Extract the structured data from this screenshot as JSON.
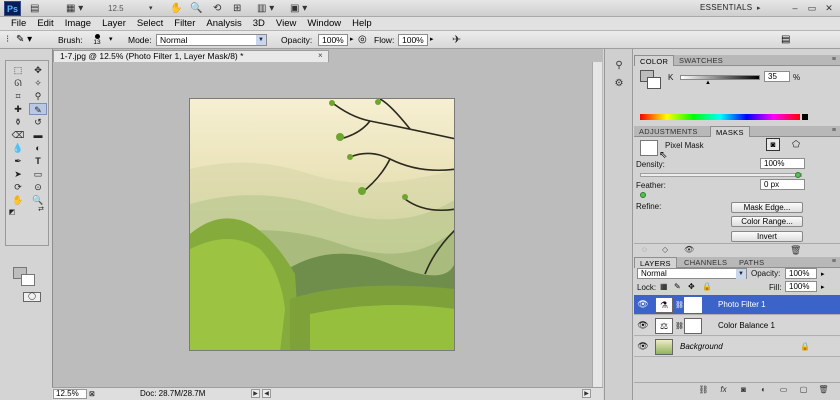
{
  "appbar": {
    "logo": "Ps",
    "zoom": "12.5",
    "workspace": "ESSENTIALS",
    "icons": [
      "document-icon",
      "hand-icon",
      "zoom-icon",
      "rotate-icon",
      "arrange-icon",
      "screen-mode-icon"
    ],
    "window_buttons": [
      "minimize-icon",
      "restore-icon",
      "close-icon"
    ]
  },
  "menu": [
    "File",
    "Edit",
    "Image",
    "Layer",
    "Select",
    "Filter",
    "Analysis",
    "3D",
    "View",
    "Window",
    "Help"
  ],
  "options": {
    "brush_label": "Brush:",
    "brush_size": "13",
    "mode_label": "Mode:",
    "mode_value": "Normal",
    "opacity_label": "Opacity:",
    "opacity_value": "100%",
    "flow_label": "Flow:",
    "flow_value": "100%"
  },
  "document": {
    "tab_title": "1-7.jpg @ 12.5% (Photo Filter 1, Layer Mask/8) *",
    "close": "×",
    "status_zoom": "12.5%",
    "doc_size": "Doc: 28.7M/28.7M"
  },
  "color_panel": {
    "tabs": [
      "COLOR",
      "SWATCHES"
    ],
    "channel_label": "K",
    "channel_value": "35",
    "unit": "%",
    "fg_color": "#bcbcbc"
  },
  "masks_panel": {
    "tabs": [
      "ADJUSTMENTS",
      "MASKS"
    ],
    "mask_type": "Pixel Mask",
    "density_label": "Density:",
    "density_value": "100%",
    "density_level": 1.0,
    "feather_label": "Feather:",
    "feather_value": "0 px",
    "feather_level": 0.0,
    "refine_label": "Refine:",
    "buttons": [
      "Mask Edge...",
      "Color Range...",
      "Invert"
    ]
  },
  "layers_panel": {
    "tabs": [
      "LAYERS",
      "CHANNELS",
      "PATHS"
    ],
    "blend_mode": "Normal",
    "opacity_label": "Opacity:",
    "opacity_value": "100%",
    "lock_label": "Lock:",
    "fill_label": "Fill:",
    "fill_value": "100%",
    "layers": [
      {
        "name": "Photo Filter 1",
        "selected": true
      },
      {
        "name": "Color Balance 1",
        "selected": false
      },
      {
        "name": "Background",
        "selected": false
      }
    ],
    "footer_icons": [
      "link-icon",
      "fx-icon",
      "add-mask-icon",
      "adjustment-icon",
      "group-icon",
      "new-layer-icon",
      "trash-icon"
    ]
  },
  "colors": {
    "selection": "#3c64c8",
    "ps_logo_bg": "#0a1e55"
  }
}
